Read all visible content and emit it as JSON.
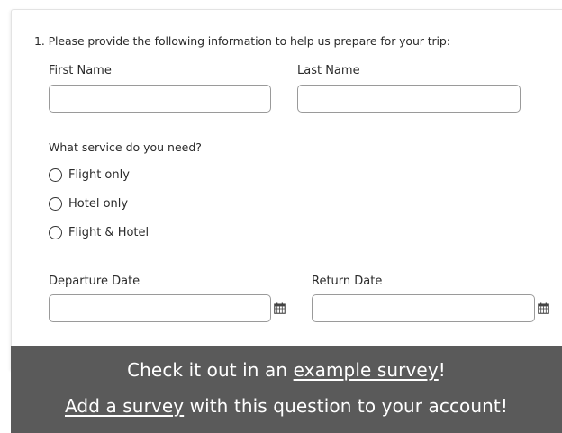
{
  "question": {
    "title": "1. Please provide the following information to help us prepare for your trip:"
  },
  "name_fields": {
    "first_label": "First Name",
    "first_value": "",
    "last_label": "Last Name",
    "last_value": ""
  },
  "service": {
    "prompt": "What service do you need?",
    "options": [
      {
        "label": "Flight only",
        "selected": false
      },
      {
        "label": "Hotel only",
        "selected": false
      },
      {
        "label": "Flight & Hotel",
        "selected": false
      }
    ]
  },
  "date_fields": {
    "departure_label": "Departure Date",
    "departure_value": "",
    "return_label": "Return Date",
    "return_value": "",
    "icon": "calendar-icon"
  },
  "cta": {
    "line1_prefix": "Check it out in an ",
    "line1_link": "example survey",
    "line1_suffix": "!",
    "line2_link": "Add a survey",
    "line2_suffix": " with this question to your account!",
    "background": "#5a5a5a",
    "text_color": "#ffffff"
  }
}
